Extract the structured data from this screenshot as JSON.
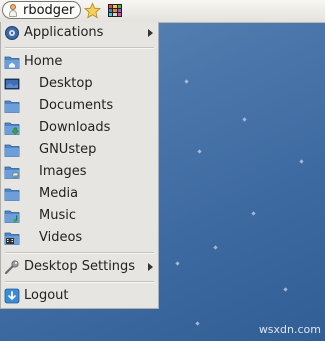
{
  "panel": {
    "username": "rbodger",
    "user_icon": "user-icon",
    "star_icon": "star-icon",
    "apps_icon": "app-grid-icon"
  },
  "menu": {
    "applications": "Applications",
    "home": "Home",
    "places": [
      {
        "label": "Desktop",
        "icon": "desktop-folder-icon"
      },
      {
        "label": "Documents",
        "icon": "folder-icon"
      },
      {
        "label": "Downloads",
        "icon": "downloads-folder-icon"
      },
      {
        "label": "GNUstep",
        "icon": "folder-icon"
      },
      {
        "label": "Images",
        "icon": "pictures-folder-icon"
      },
      {
        "label": "Media",
        "icon": "folder-icon"
      },
      {
        "label": "Music",
        "icon": "music-folder-icon"
      },
      {
        "label": "Videos",
        "icon": "videos-folder-icon"
      }
    ],
    "desktop_settings": "Desktop Settings",
    "logout": "Logout"
  },
  "watermark": "wsxdn.com",
  "colors": {
    "desktop_blue": "#4a76ab",
    "menu_bg": "#e6e5e1",
    "folder_blue": "#4f86c6"
  }
}
